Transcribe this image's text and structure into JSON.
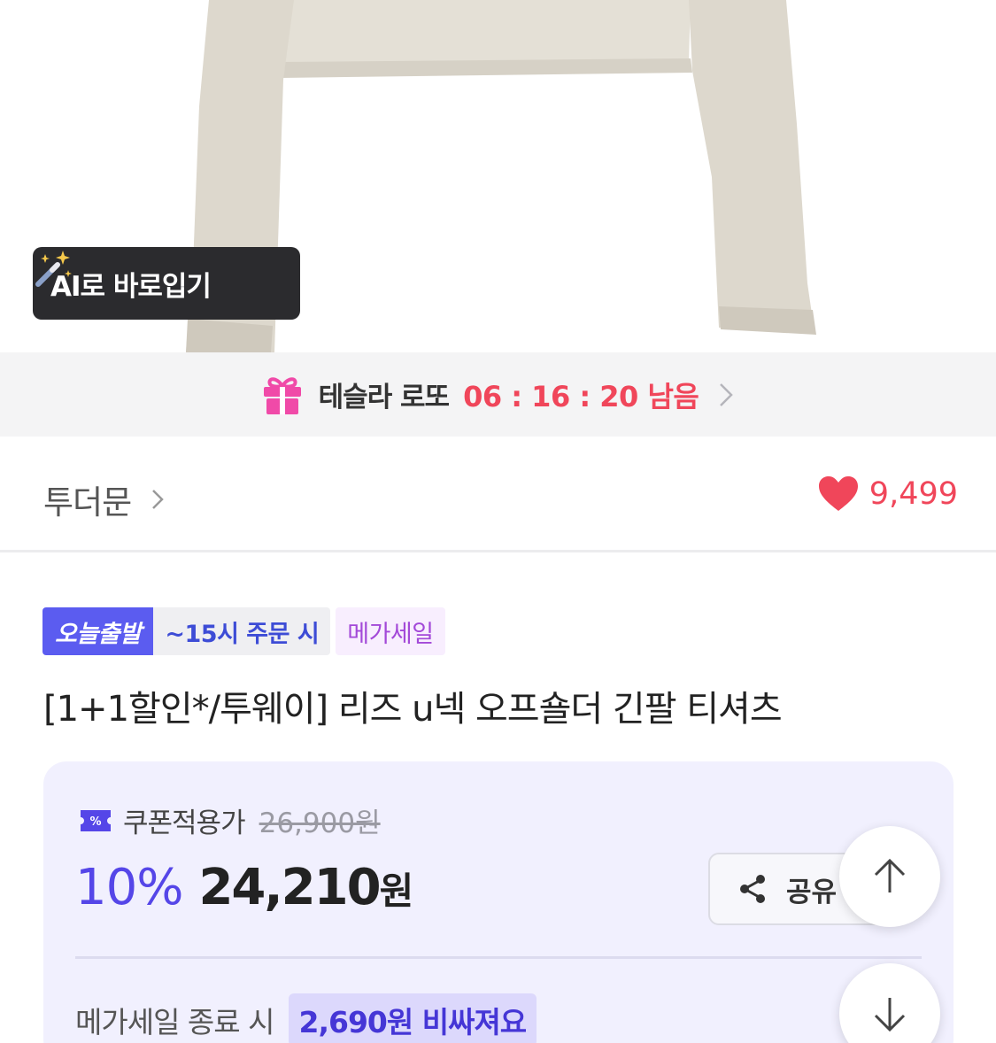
{
  "hero": {
    "ai_try_on_label": "AI로 바로입기",
    "icon": "magic-wand-icon"
  },
  "lotto_banner": {
    "icon": "gift-icon",
    "title": "테슬라 로또",
    "timer": "06 : 16 : 20 남음",
    "timer_color": "#f0465a"
  },
  "brand": {
    "name": "투더문",
    "likes_count": "9,499",
    "heart_color": "#f0465a"
  },
  "tags": {
    "today_shipping": "오늘출발",
    "deadline": "~15시 주문 시",
    "mega_sale": "메가세일"
  },
  "product": {
    "title": "[1+1할인*/투웨이] 리즈 u넥 오프숄더 긴팔 티셔츠"
  },
  "price": {
    "coupon_label": "쿠폰적용가",
    "original_price": "26,900원",
    "discount_rate": "10%",
    "sale_price": "24,210",
    "currency": "원",
    "share_label": "공유",
    "mega_end_label": "메가세일 종료 시",
    "mega_end_badge": "2,690원 비싸져요",
    "accent_color": "#5546e8"
  }
}
